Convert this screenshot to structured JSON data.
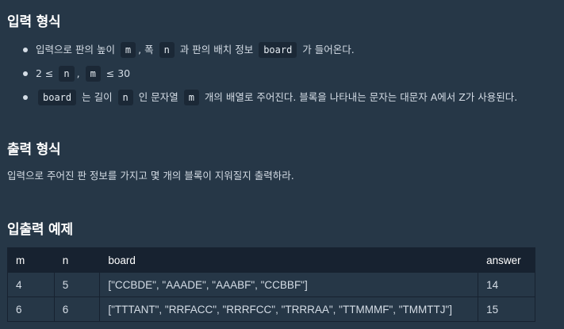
{
  "input_section": {
    "title": "입력 형식",
    "bullets": [
      {
        "parts": [
          "입력으로 판의 높이 ",
          "m",
          ", 폭 ",
          "n",
          " 과 판의 배치 정보 ",
          "board",
          " 가 들어온다."
        ]
      },
      {
        "parts": [
          "2 ≤ ",
          "n",
          ", ",
          "m",
          " ≤ 30"
        ]
      },
      {
        "parts": [
          "",
          "board",
          " 는 길이 ",
          "n",
          " 인 문자열 ",
          "m",
          " 개의 배열로 주어진다. 블록을 나타내는 문자는 대문자 A에서 Z가 사용된다."
        ]
      }
    ]
  },
  "output_section": {
    "title": "출력 형식",
    "description": "입력으로 주어진 판 정보를 가지고 몇 개의 블록이 지워질지 출력하라."
  },
  "example_section": {
    "title": "입출력 예제",
    "columns": [
      "m",
      "n",
      "board",
      "answer"
    ],
    "rows": [
      [
        "4",
        "5",
        "[\"CCBDE\", \"AAADE\", \"AAABF\", \"CCBBF\"]",
        "14"
      ],
      [
        "6",
        "6",
        "[\"TTTANT\", \"RRFACC\", \"RRRFCC\", \"TRRRAA\", \"TTMMMF\", \"TMMTTJ\"]",
        "15"
      ]
    ]
  }
}
